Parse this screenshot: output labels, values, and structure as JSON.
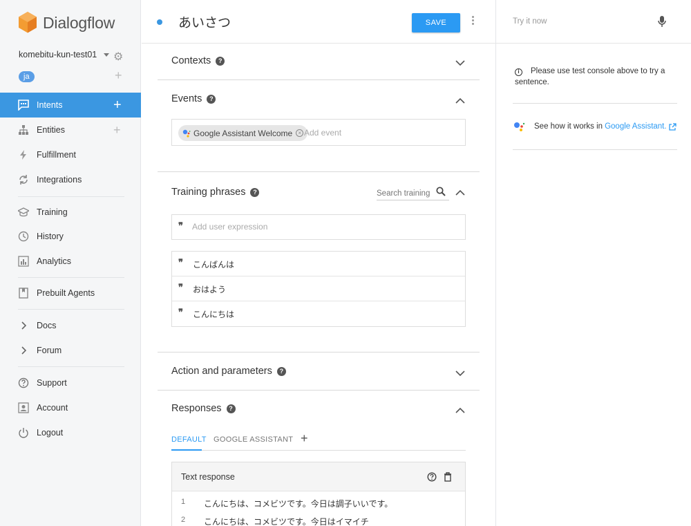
{
  "brand": {
    "name": "Dialogflow"
  },
  "agent": {
    "name": "komebitu-kun-test01",
    "language": "ja"
  },
  "nav": [
    {
      "label": "Intents",
      "icon": "chat-icon",
      "active": true,
      "has_add": true
    },
    {
      "label": "Entities",
      "icon": "entities-icon",
      "has_add": true
    },
    {
      "label": "Fulfillment",
      "icon": "lightning-icon"
    },
    {
      "label": "Integrations",
      "icon": "sync-icon"
    },
    {
      "label": "Training",
      "icon": "graduation-cap-icon"
    },
    {
      "label": "History",
      "icon": "clock-icon"
    },
    {
      "label": "Analytics",
      "icon": "bar-chart-icon"
    },
    {
      "label": "Prebuilt Agents",
      "icon": "book-icon"
    },
    {
      "label": "Docs",
      "icon": "chevron-right-icon"
    },
    {
      "label": "Forum",
      "icon": "chevron-right-icon"
    },
    {
      "label": "Support",
      "icon": "help-circle-icon"
    },
    {
      "label": "Account",
      "icon": "account-icon"
    },
    {
      "label": "Logout",
      "icon": "power-icon"
    }
  ],
  "intent": {
    "title": "あいさつ",
    "save_label": "SAVE"
  },
  "sections": {
    "contexts": "Contexts",
    "events": "Events",
    "training": "Training phrases",
    "action": "Action and parameters",
    "responses": "Responses"
  },
  "events": {
    "chip": "Google Assistant Welcome",
    "placeholder": "Add event"
  },
  "training": {
    "search_placeholder": "Search training phrases",
    "add_placeholder": "Add user expression",
    "phrases": [
      "こんばんは",
      "おはよう",
      "こんにちは"
    ]
  },
  "responses": {
    "tabs": [
      "DEFAULT",
      "GOOGLE ASSISTANT"
    ],
    "add_tab": "+",
    "card_title": "Text response",
    "lines": [
      {
        "num": "1",
        "text": "こんにちは、コメビツです。今日は調子いいです。"
      },
      {
        "num": "2",
        "text": "こんにちは、コメビツです。今日はイマイチ"
      }
    ]
  },
  "console": {
    "placeholder": "Try it now",
    "info": "Please use test console above to try a sentence.",
    "ga_text": "See how it works in",
    "ga_link": "Google Assistant."
  },
  "colors": {
    "accent": "#2b9af3",
    "active_nav": "#3b97e1",
    "sidebar_bg": "#f5f6f7"
  }
}
